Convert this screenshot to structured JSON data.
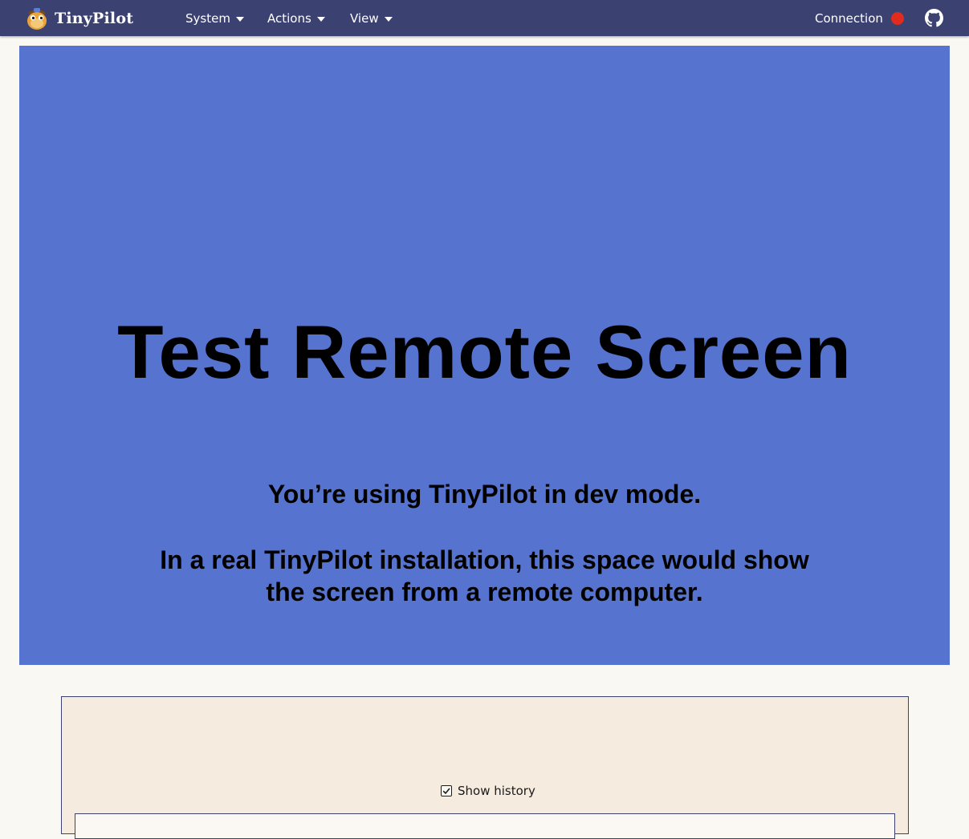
{
  "navbar": {
    "logo_text": "TinyPilot",
    "menus": [
      {
        "label": "System"
      },
      {
        "label": "Actions"
      },
      {
        "label": "View"
      }
    ],
    "connection_label": "Connection",
    "connection_status_color": "#e12b1e",
    "github_icon": "github-icon"
  },
  "remote_screen": {
    "title": "Test Remote Screen",
    "line1": "You’re using TinyPilot in dev mode.",
    "line2": "In a real TinyPilot installation, this space would show",
    "line3": "the screen from a remote computer.",
    "background": "#5573cf"
  },
  "history": {
    "label": "Show history",
    "checked": true
  },
  "colors": {
    "navbar_bg": "#3b4272",
    "page_bg": "#faf8f3",
    "panel_bg": "#f5ecdf"
  }
}
